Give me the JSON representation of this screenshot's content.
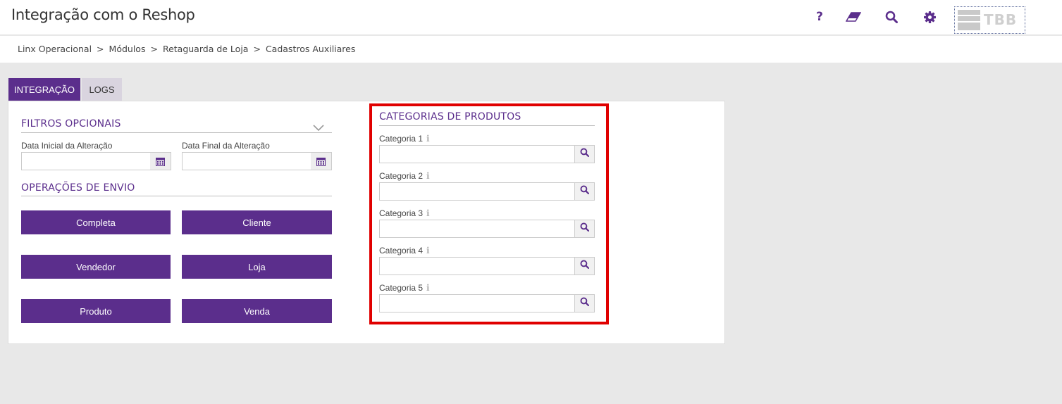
{
  "header": {
    "title": "Integração com o Reshop",
    "help_label": "?",
    "logo_text": "TBB"
  },
  "breadcrumb": [
    "Linx Operacional",
    "Módulos",
    "Retaguarda de Loja",
    "Cadastros Auxiliares"
  ],
  "breadcrumb_separator": ">",
  "tabs": {
    "integration": "INTEGRAÇÃO",
    "logs": "LOGS"
  },
  "filters": {
    "title": "FILTROS OPCIONAIS",
    "start_date_label": "Data Inicial da Alteração",
    "start_date_value": "",
    "end_date_label": "Data Final da Alteração",
    "end_date_value": ""
  },
  "operations": {
    "title": "OPERAÇÕES DE ENVIO",
    "buttons": [
      "Completa",
      "Cliente",
      "Vendedor",
      "Loja",
      "Produto",
      "Venda"
    ]
  },
  "categories": {
    "title": "CATEGORIAS DE PRODUTOS",
    "info_glyph": "i",
    "items": [
      {
        "label": "Categoria 1",
        "value": ""
      },
      {
        "label": "Categoria 2",
        "value": ""
      },
      {
        "label": "Categoria 3",
        "value": ""
      },
      {
        "label": "Categoria 4",
        "value": ""
      },
      {
        "label": "Categoria 5",
        "value": ""
      }
    ]
  },
  "colors": {
    "accent": "#5b2e8c",
    "highlight_border": "#e00000",
    "tab_inactive": "#d9d4df"
  },
  "icons": [
    "help-icon",
    "eraser-icon",
    "search-icon",
    "gear-icon",
    "calendar-icon",
    "chevron-down-icon",
    "info-icon"
  ]
}
